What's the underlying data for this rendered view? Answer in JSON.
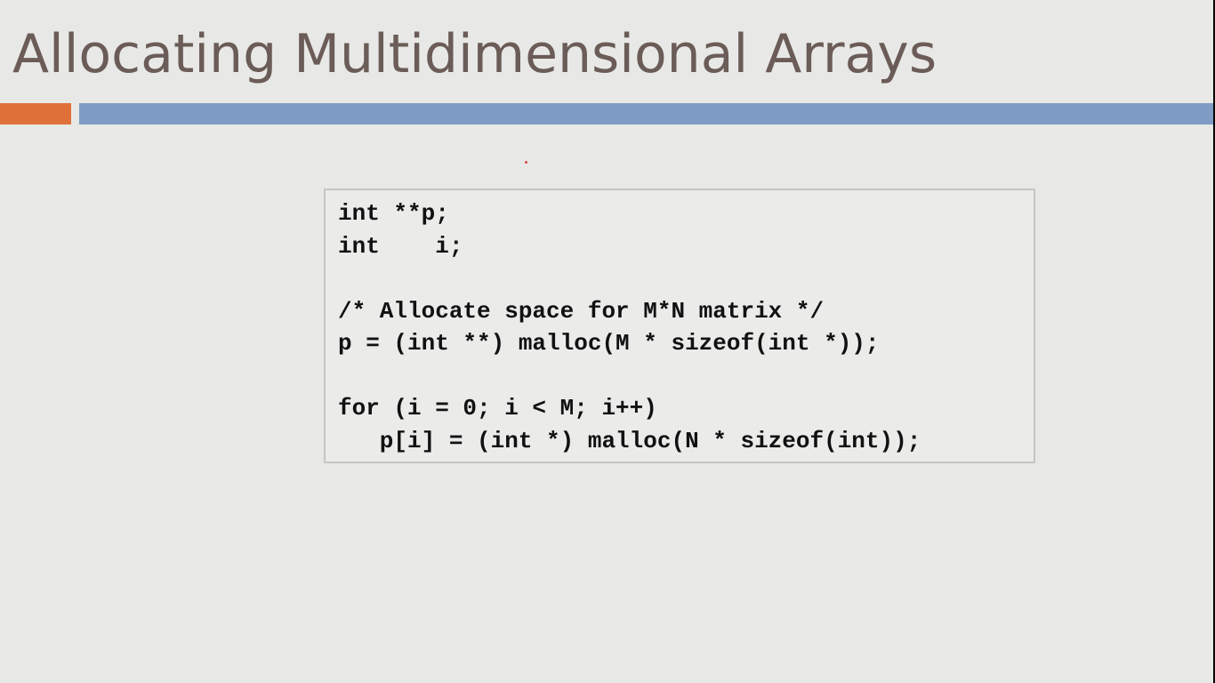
{
  "slide": {
    "title": "Allocating Multidimensional Arrays",
    "accent_colors": {
      "left_bar": "#e0703a",
      "right_bar": "#7f9cc4",
      "dot": "#d9473f"
    },
    "code_lines": [
      "int **p;",
      "int    i;",
      "",
      "/* Allocate space for M*N matrix */",
      "p = (int **) malloc(M * sizeof(int *));",
      "",
      "for (i = 0; i < M; i++)",
      "   p[i] = (int *) malloc(N * sizeof(int));"
    ]
  }
}
